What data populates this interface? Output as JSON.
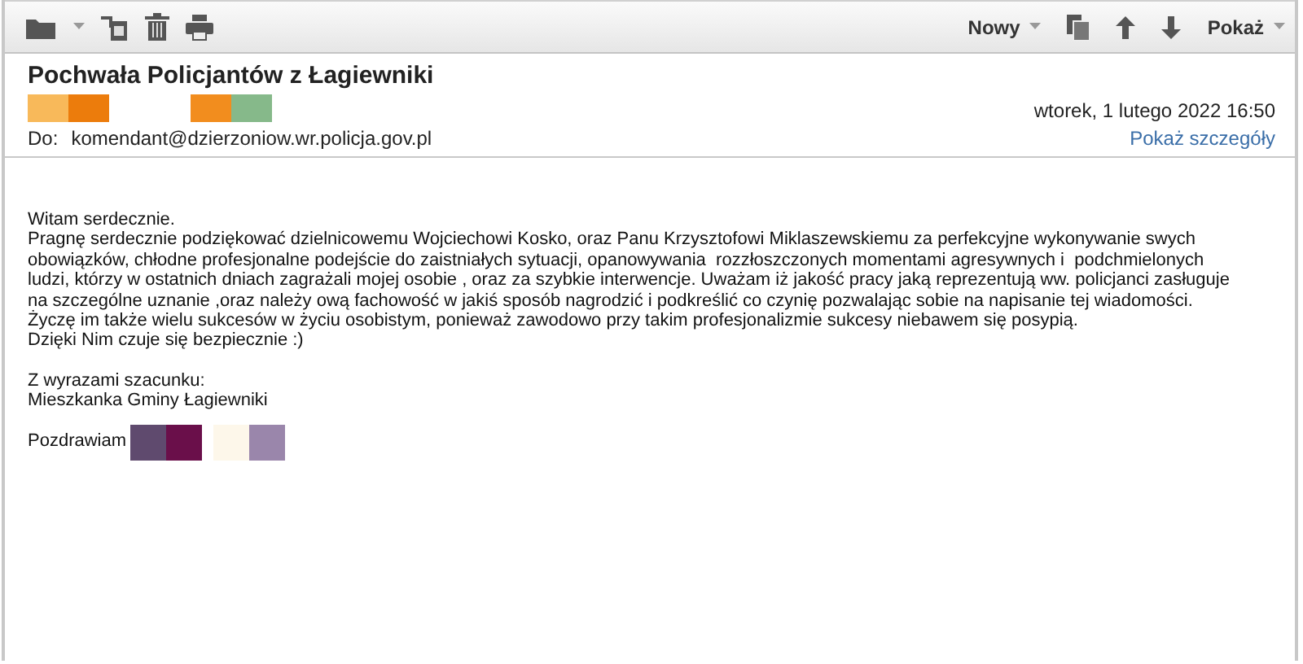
{
  "toolbar": {
    "left": [
      {
        "kind": "folder"
      },
      {
        "kind": "caret"
      },
      {
        "kind": "move"
      },
      {
        "kind": "trash"
      },
      {
        "kind": "print"
      }
    ],
    "right": [
      {
        "kind": "menu",
        "label": "Nowy"
      },
      {
        "kind": "copy"
      },
      {
        "kind": "up"
      },
      {
        "kind": "down"
      },
      {
        "kind": "menu",
        "label": "Pokaż"
      }
    ]
  },
  "message": {
    "subject": "Pochwała Policjantów z Łagiewniki",
    "sender_redactions": [
      {
        "color": "#f8b95a"
      },
      {
        "color": "#ec7c0c"
      },
      {
        "color": "#f28d1e"
      },
      {
        "color": "#86b98a"
      }
    ],
    "to_label": "Do:",
    "to": "komendant@dzierzoniow.wr.policja.gov.pl",
    "date": "wtorek, 1 lutego 2022 16:50",
    "details_link": "Pokaż szczegóły",
    "body": [
      "Witam serdecznie.",
      "Pragnę serdecznie podziękować dzielnicowemu Wojciechowi Kosko, oraz Panu Krzysztofowi Miklaszewskiemu za perfekcyjne wykonywanie swych",
      "obowiązków, chłodne profesjonalne podejście do zaistniałych sytuacji, opanowywania  rozzłoszczonych momentami agresywnych i  podchmielonych",
      "ludzi, którzy w ostatnich dniach zagrażali mojej osobie , oraz za szybkie interwencje. Uważam iż jakość pracy jaką reprezentują ww. policjanci zasługuje",
      "na szczególne uznanie ,oraz należy ową fachowość w jakiś sposób nagrodzić i podkreślić co czynię pozwalając sobie na napisanie tej wiadomości.",
      "Życzę im także wielu sukcesów w życiu osobistym, ponieważ zawodowo przy takim profesjonalizmie sukcesy niebawem się posypią.",
      "Dzięki Nim czuje się bezpiecznie :)"
    ],
    "closing": [
      "Z wyrazami szacunku:",
      "Mieszkanka Gminy Łagiewniki"
    ],
    "greeting": "Pozdrawiam",
    "greeting_redactions": [
      {
        "color": "#5f4a6e"
      },
      {
        "color": "#6a0f4a"
      },
      {
        "color": "#fdf7ea"
      },
      {
        "color": "#9a86ab"
      }
    ]
  }
}
